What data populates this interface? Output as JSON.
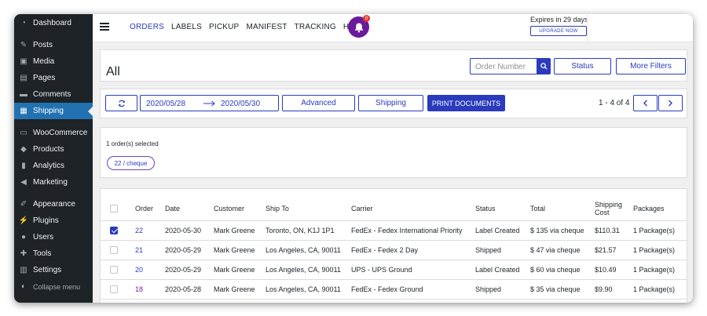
{
  "sidebar": {
    "items": [
      {
        "label": "Dashboard",
        "icon": "dashboard-icon"
      },
      {
        "label": "Posts",
        "icon": "pin-icon"
      },
      {
        "label": "Media",
        "icon": "media-icon"
      },
      {
        "label": "Pages",
        "icon": "pages-icon"
      },
      {
        "label": "Comments",
        "icon": "comment-icon"
      },
      {
        "label": "Shipping",
        "icon": "grid-icon"
      },
      {
        "label": "WooCommerce",
        "icon": "woo-icon"
      },
      {
        "label": "Products",
        "icon": "box-icon"
      },
      {
        "label": "Analytics",
        "icon": "bar-chart-icon"
      },
      {
        "label": "Marketing",
        "icon": "megaphone-icon"
      },
      {
        "label": "Appearance",
        "icon": "brush-icon"
      },
      {
        "label": "Plugins",
        "icon": "plug-icon"
      },
      {
        "label": "Users",
        "icon": "user-icon"
      },
      {
        "label": "Tools",
        "icon": "wrench-icon"
      },
      {
        "label": "Settings",
        "icon": "settings-icon"
      },
      {
        "label": "Collapse menu",
        "icon": "collapse-icon"
      }
    ]
  },
  "topbar": {
    "nav": [
      "ORDERS",
      "LABELS",
      "PICKUP",
      "MANIFEST",
      "TRACKING",
      "HELP"
    ],
    "badge": "0",
    "expires": "Expires in 29 days",
    "upgrade": "UPGRADE NOW"
  },
  "header": {
    "title": "All",
    "search_placeholder": "Order Number",
    "status_label": "Status",
    "more_filters_label": "More Filters"
  },
  "toolbar": {
    "date_from": "2020/05/28",
    "date_to": "2020/05/30",
    "advanced_label": "Advanced",
    "shipping_label": "Shipping",
    "print_label": "PRINT DOCUMENTS",
    "range": "1 - 4 of 4"
  },
  "selection": {
    "text": "1 order(s) selected",
    "chip": "22 / cheque"
  },
  "table": {
    "headers": [
      "Order",
      "Date",
      "Customer",
      "Ship To",
      "Carrier",
      "Status",
      "Total",
      "Shipping Cost",
      "Packages"
    ],
    "rows": [
      {
        "checked": true,
        "order": "22",
        "date": "2020-05-30",
        "customer": "Mark Greene",
        "ship_to": "Toronto, ON, K1J 1P1",
        "carrier": "FedEx - Fedex International Priority",
        "status": "Label Created",
        "total": "$ 135 via cheque",
        "shipping_cost": "$110.31",
        "packages": "1 Package(s)"
      },
      {
        "checked": false,
        "order": "21",
        "date": "2020-05-29",
        "customer": "Mark Greene",
        "ship_to": "Los Angeles, CA, 90011",
        "carrier": "FedEx - Fedex 2 Day",
        "status": "Shipped",
        "total": "$ 47 via cheque",
        "shipping_cost": "$21.57",
        "packages": "1 Package(s)"
      },
      {
        "checked": false,
        "order": "20",
        "date": "2020-05-29",
        "customer": "Mark Greene",
        "ship_to": "Los Angeles, CA, 90011",
        "carrier": "UPS - UPS Ground",
        "status": "Label Created",
        "total": "$ 60 via cheque",
        "shipping_cost": "$10.49",
        "packages": "1 Package(s)"
      },
      {
        "checked": false,
        "order": "18",
        "date": "2020-05-28",
        "customer": "Mark Greene",
        "ship_to": "Los Angeles, CA, 90011",
        "carrier": "FedEx - Fedex Ground",
        "status": "Shipped",
        "total": "$ 35 via cheque",
        "shipping_cost": "$9.90",
        "packages": "1 Package(s)"
      }
    ]
  },
  "colors": {
    "sidebar_bg": "#1d2327",
    "active_bg": "#2271b1",
    "accent": "#2a3bbd",
    "bell_bg": "#6a1b9a"
  }
}
